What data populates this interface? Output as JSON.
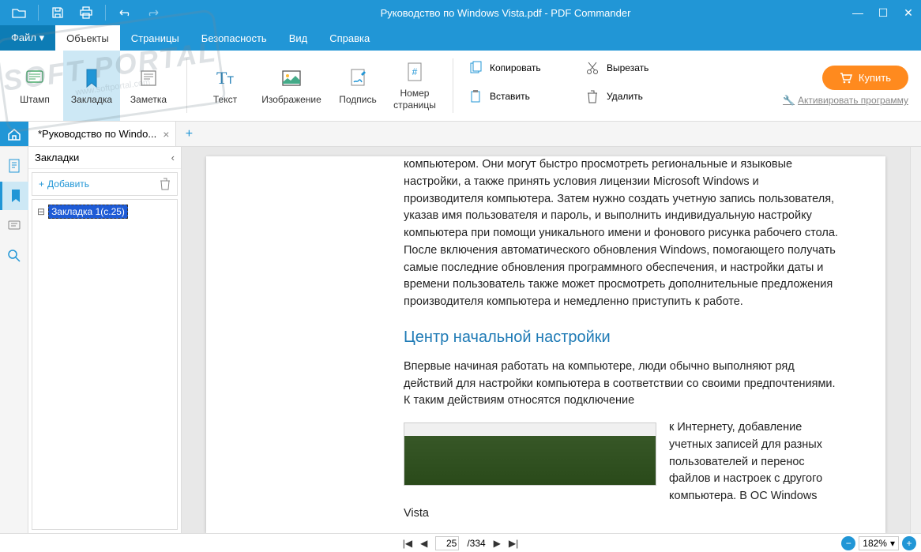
{
  "titlebar": {
    "title": "Руководство по Windows Vista.pdf - PDF Commander"
  },
  "menu": {
    "file": "Файл ▾",
    "objects": "Объекты",
    "pages": "Страницы",
    "security": "Безопасность",
    "view": "Вид",
    "help": "Справка"
  },
  "ribbon": {
    "stamp": "Штамп",
    "bookmark": "Закладка",
    "note": "Заметка",
    "text": "Текст",
    "image": "Изображение",
    "signature": "Подпись",
    "page_number": "Номер\nстраницы",
    "copy": "Копировать",
    "cut": "Вырезать",
    "paste": "Вставить",
    "delete": "Удалить",
    "buy": "Купить",
    "activate": "Активировать программу"
  },
  "tabs": {
    "doc_name": "*Руководство по Windo..."
  },
  "bookmarks": {
    "title": "Закладки",
    "add": "Добавить",
    "item1": "Закладка 1(с.25)"
  },
  "document": {
    "para1": "компьютером. Они могут быстро просмотреть региональные и языковые настройки, а также принять условия лицензии Microsoft Windows и производителя компьютера. Затем нужно создать учетную запись пользователя, указав имя пользователя и пароль, и выполнить индивидуальную настройку компьютера при помощи уникального имени и фонового рисунка рабочего стола. После включения автоматического обновления Windows, помогающего получать самые последние обновления программного обеспечения, и настройки даты и времени пользователь также может просмотреть дополнительные предложения производителя компьютера и немедленно приступить к работе.",
    "heading": "Центр начальной настройки",
    "para2": "Впервые начиная работать на компьютере, люди обычно выполняют ряд действий для настройки компьютера в соответствии со своими предпочтениями. К таким действиям относятся подключение",
    "para3": "к Интернету, добавление учетных записей для разных пользователей и перенос файлов и настроек с другого компьютера. В ОС Windows Vista"
  },
  "status": {
    "current_page": "25",
    "total_pages": "/334",
    "zoom": "182%"
  },
  "watermark": {
    "big": "SOFT PORTAL",
    "small": "www.softportal.com"
  }
}
